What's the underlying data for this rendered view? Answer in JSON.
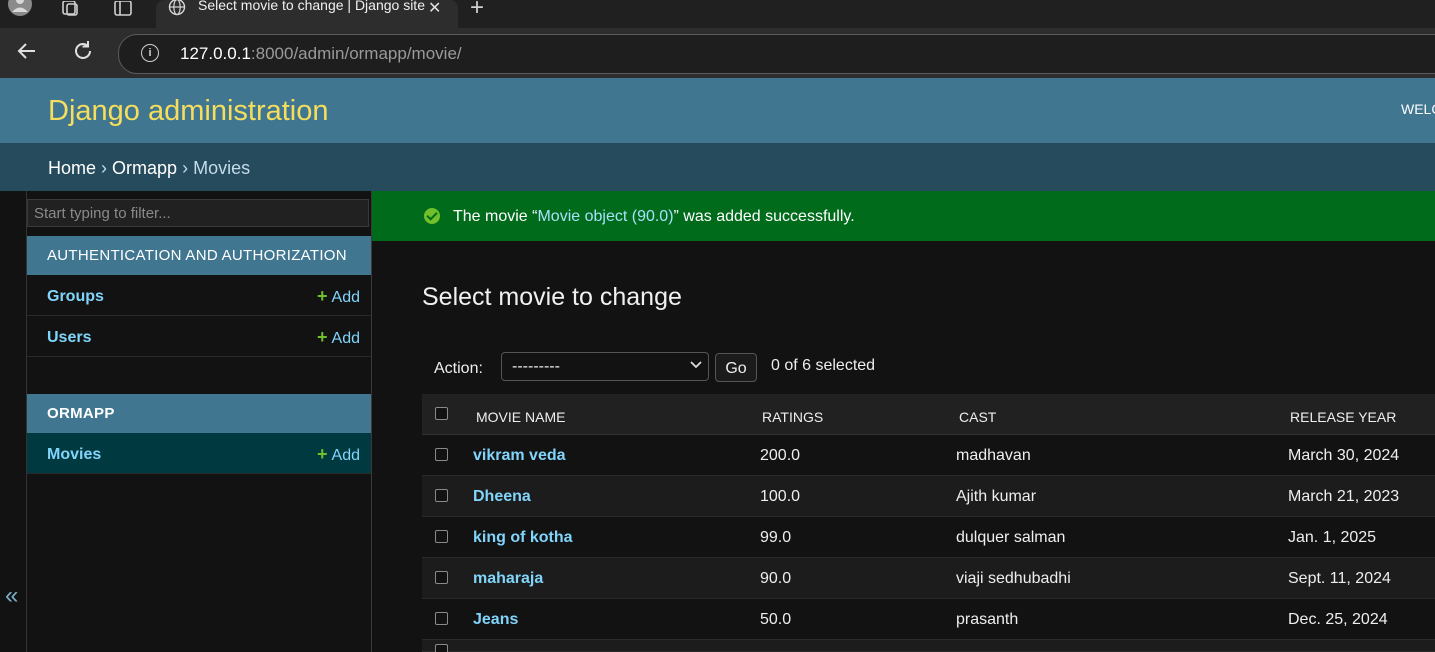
{
  "browser": {
    "tab_title": "Select movie to change | Django site admin",
    "url_host": "127.0.0.1",
    "url_rest": ":8000/admin/ormapp/movie/"
  },
  "header": {
    "branding": "Django administration",
    "user_tools": "WELCOME,"
  },
  "breadcrumbs": {
    "home": "Home",
    "sep": "›",
    "app": "Ormapp",
    "current": "Movies"
  },
  "sidebar": {
    "filter_placeholder": "Start typing to filter...",
    "toggle": "«",
    "add_label": "Add",
    "modules": [
      {
        "caption": "AUTHENTICATION AND AUTHORIZATION",
        "models": [
          {
            "name": "Groups"
          },
          {
            "name": "Users"
          }
        ]
      },
      {
        "caption": "ORMAPP",
        "models": [
          {
            "name": "Movies",
            "selected": true
          }
        ]
      }
    ]
  },
  "message": {
    "before": "The movie “",
    "link": "Movie object (90.0)",
    "after": "” was added successfully."
  },
  "page_title": "Select movie to change",
  "actions": {
    "label": "Action:",
    "selected_option": "---------",
    "go": "Go",
    "counter": "0 of 6 selected"
  },
  "table": {
    "columns": [
      "MOVIE NAME",
      "RATINGS",
      "CAST",
      "RELEASE YEAR"
    ],
    "rows": [
      {
        "name": "vikram veda",
        "rating": "200.0",
        "cast": "madhavan",
        "release": "March 30, 2024"
      },
      {
        "name": "Dheena",
        "rating": "100.0",
        "cast": "Ajith kumar",
        "release": "March 21, 2023"
      },
      {
        "name": "king of kotha",
        "rating": "99.0",
        "cast": "dulquer salman",
        "release": "Jan. 1, 2025"
      },
      {
        "name": "maharaja",
        "rating": "90.0",
        "cast": "viaji sedhubadhi",
        "release": "Sept. 11, 2024"
      },
      {
        "name": "Jeans",
        "rating": "50.0",
        "cast": "prasanth",
        "release": "Dec. 25, 2024"
      }
    ]
  },
  "colors": {
    "header_bg": "#417690",
    "breadcrumbs_bg": "#264b5d",
    "branding": "#f5dd5d",
    "link": "#81d4fa",
    "success_bg": "#006b1b",
    "add_plus": "#70bf2b"
  }
}
